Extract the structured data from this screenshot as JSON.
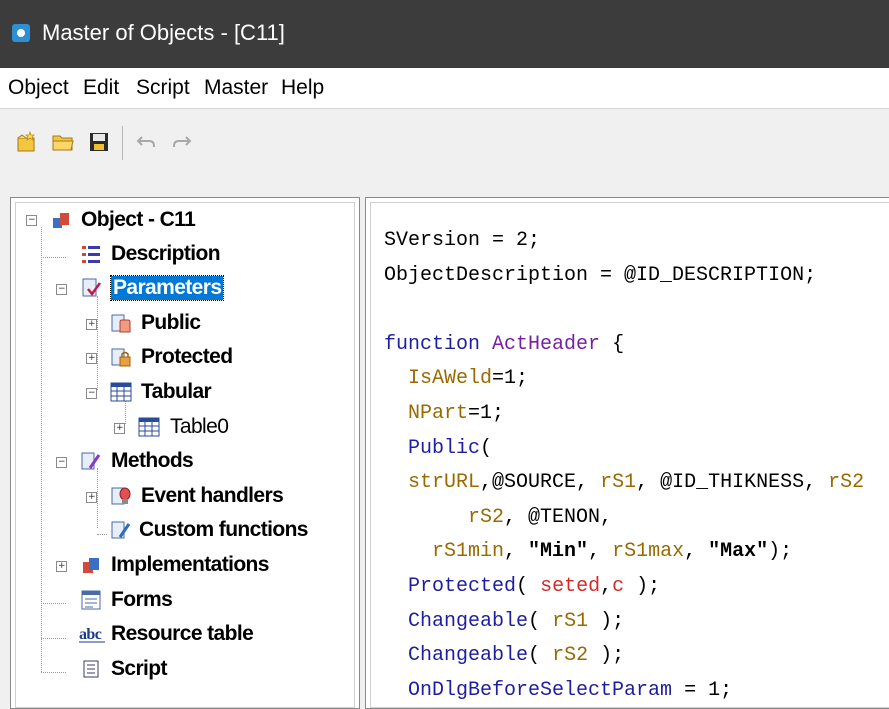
{
  "window": {
    "title": "Master of Objects - [C11]"
  },
  "menu": [
    {
      "label": "Object"
    },
    {
      "label": "Edit"
    },
    {
      "label": "Script"
    },
    {
      "label": "Master"
    },
    {
      "label": "Help"
    }
  ],
  "toolbar": {
    "icons": [
      "new-icon",
      "open-folder-icon",
      "save-icon",
      "undo-icon",
      "redo-icon"
    ]
  },
  "tree": {
    "root": "Object - C11",
    "description": "Description",
    "parameters": "Parameters",
    "public": "Public",
    "protected": "Protected",
    "tabular": "Tabular",
    "table0": "Table0",
    "methods": "Methods",
    "event_handlers": "Event handlers",
    "custom_functions": "Custom functions",
    "implementations": "Implementations",
    "forms": "Forms",
    "resource_table": "Resource table",
    "script": "Script",
    "selected": "Parameters"
  },
  "code": {
    "l1": "SVersion = 2;",
    "l2": "ObjectDescription = @ID_DESCRIPTION;",
    "l4_kw": "function",
    "l4_fn": "ActHeader",
    "l4_rest": " {",
    "l5_var": "IsAWeld",
    "l5_rest": "=1;",
    "l6_var": "NPart",
    "l6_rest": "=1;",
    "l7_kw": "Public",
    "l7_rest": "(",
    "l8_a": "strURL",
    "l8_b": ",@SOURCE, ",
    "l8_c": "rS1",
    "l8_d": ", @ID_THIKNESS, ",
    "l8_e": "rS2",
    "l9_a": "rS2",
    "l9_b": ", @TENON,",
    "l10_a": "rS1min",
    "l10_b": ", ",
    "l10_c": "\"Min\"",
    "l10_d": ", ",
    "l10_e": "rS1max",
    "l10_f": ", ",
    "l10_g": "\"Max\"",
    "l10_h": ");",
    "l11_kw": "Protected",
    "l11_b": "( ",
    "l11_c": "seted",
    "l11_d": ",",
    "l11_e": "c",
    "l11_f": " );",
    "l12_kw": "Changeable",
    "l12_b": "( ",
    "l12_c": "rS1",
    "l12_d": " );",
    "l13_kw": "Changeable",
    "l13_b": "( ",
    "l13_c": "rS2",
    "l13_d": " );",
    "l14_kw": "OnDlgBeforeSelectParam",
    "l14_b": " = 1;"
  },
  "colors": {
    "keyword": "#1e1ea0",
    "function_name": "#7a1fa2",
    "variable": "#9a6a00",
    "highlight": "#d42a2a",
    "selection": "#0078d7"
  }
}
